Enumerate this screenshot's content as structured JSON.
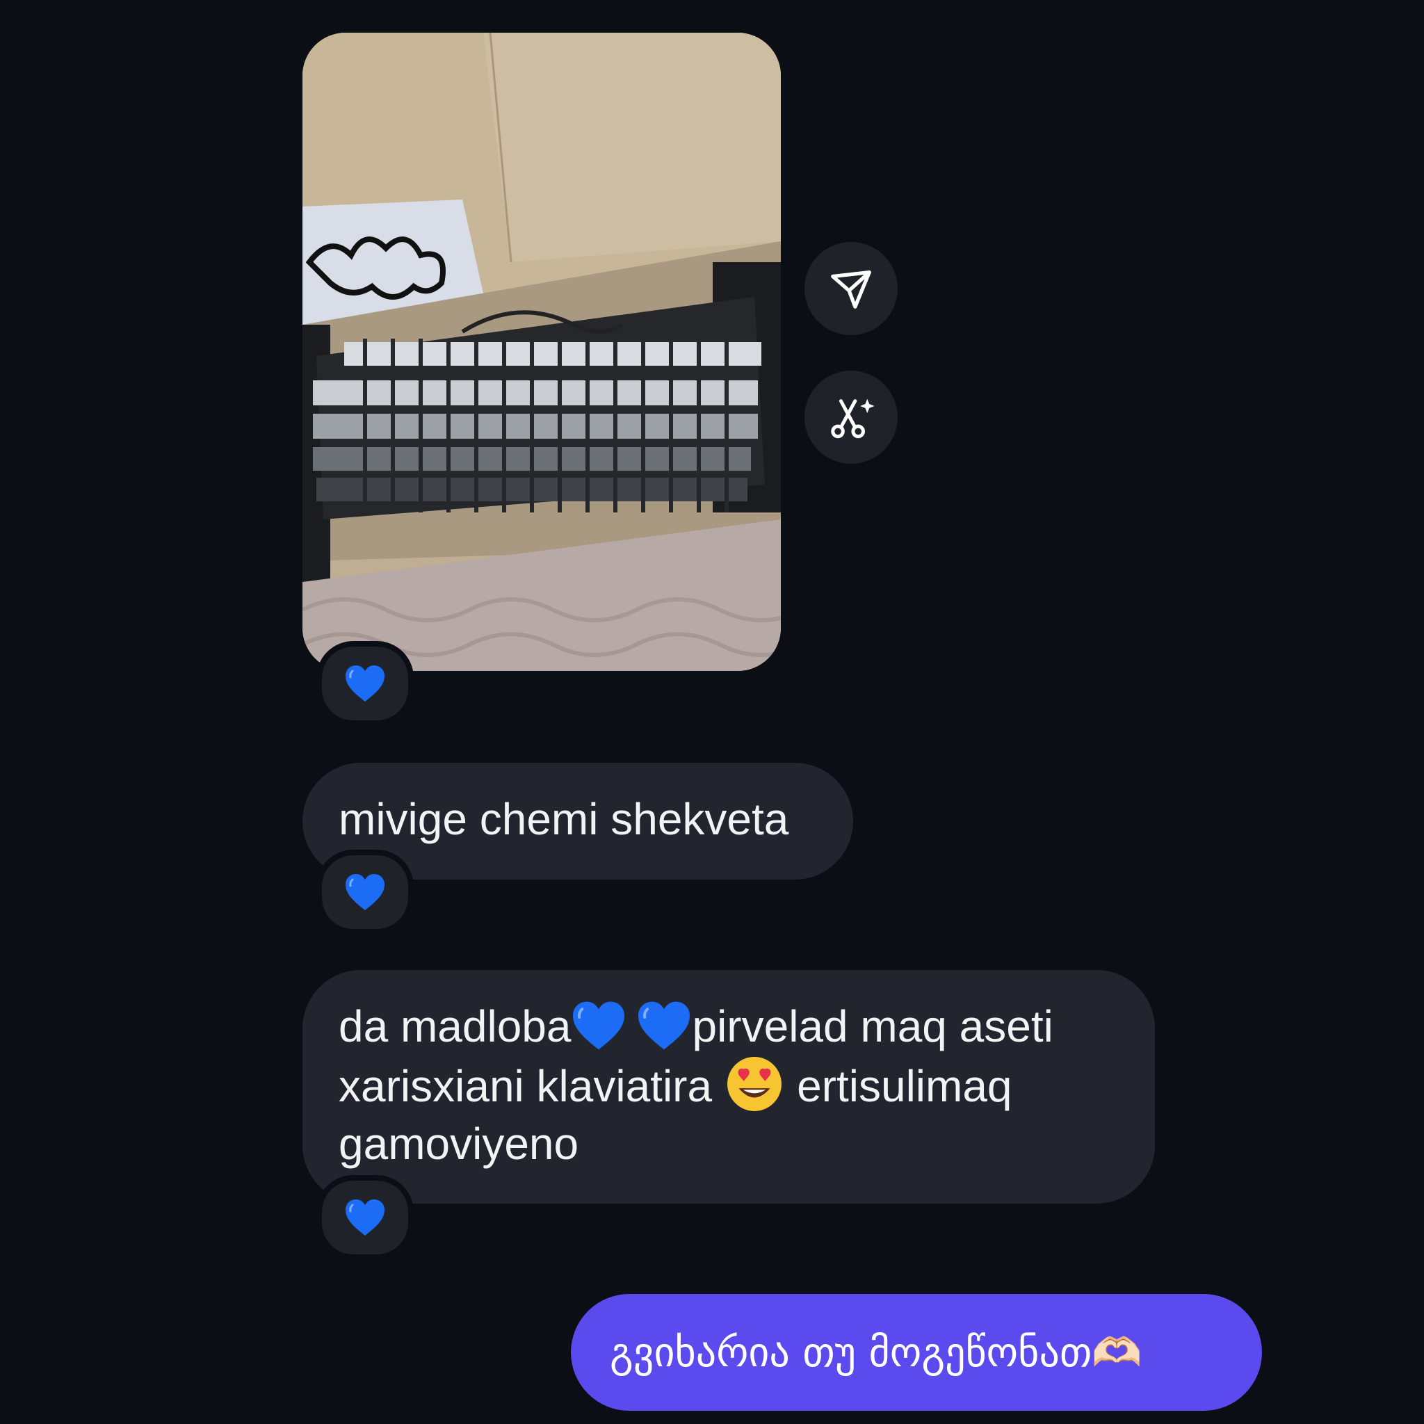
{
  "conversation": {
    "messages": [
      {
        "type": "image",
        "alt": "",
        "reaction": "💙"
      },
      {
        "type": "text",
        "text": "mivige chemi shekveta",
        "reaction": "💙"
      },
      {
        "type": "text",
        "segments": {
          "a": "da madloba",
          "b": "pirvelad maq aseti xarisxiani klaviatira",
          "c": "ertisulimaq gamoviyeno"
        },
        "emojis": [
          "💙",
          "💙",
          "😍"
        ],
        "reaction": "💙"
      },
      {
        "type": "text",
        "own": true,
        "text": "გვიხარია თუ მოგეწონათ🫶🏻"
      }
    ]
  },
  "actions": {
    "share_icon": "paper-plane-icon",
    "remix_icon": "sparkle-scissors-icon"
  },
  "colors": {
    "background": "#0b0e14",
    "incoming_bubble": "#22252d",
    "outgoing_bubble": "#5b4bee",
    "heart": "#1c6cf5"
  }
}
